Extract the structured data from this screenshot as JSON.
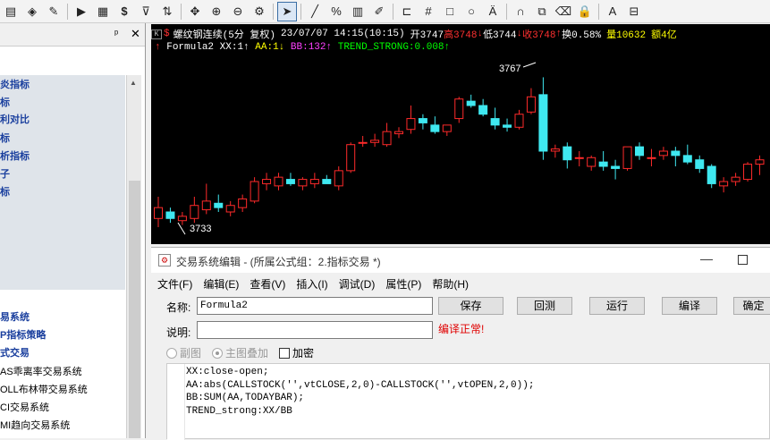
{
  "toolbar": {
    "buttons": [
      {
        "name": "menu-icon",
        "glyph": "▤"
      },
      {
        "name": "indicator-icon",
        "glyph": "◈"
      },
      {
        "name": "edit-icon",
        "glyph": "✎"
      },
      {
        "name": "play-icon",
        "glyph": "▶"
      },
      {
        "name": "document-icon",
        "glyph": "▦"
      },
      {
        "name": "dollar-icon",
        "glyph": "$"
      },
      {
        "name": "filter-icon",
        "glyph": "⊽"
      },
      {
        "name": "sync-icon",
        "glyph": "⇅"
      },
      {
        "name": "move-icon",
        "glyph": "✥"
      },
      {
        "name": "zoom-in-icon",
        "glyph": "⊕"
      },
      {
        "name": "zoom-out-icon",
        "glyph": "⊖"
      },
      {
        "name": "settings-icon",
        "glyph": "⚙"
      },
      {
        "name": "pointer-icon",
        "glyph": "➤"
      },
      {
        "name": "line-icon",
        "glyph": "╱"
      },
      {
        "name": "percent-icon",
        "glyph": "%"
      },
      {
        "name": "grid-icon",
        "glyph": "▥"
      },
      {
        "name": "pen-icon",
        "glyph": "✐"
      },
      {
        "name": "bracket-icon",
        "glyph": "⊏"
      },
      {
        "name": "hash-icon",
        "glyph": "#"
      },
      {
        "name": "rect-icon",
        "glyph": "□"
      },
      {
        "name": "circle-icon",
        "glyph": "○"
      },
      {
        "name": "text-icon",
        "glyph": "Ä"
      },
      {
        "name": "magnet-icon",
        "glyph": "∩"
      },
      {
        "name": "copy-icon",
        "glyph": "⧉"
      },
      {
        "name": "eraser-icon",
        "glyph": "⌫"
      },
      {
        "name": "lock-icon",
        "glyph": "🔒"
      },
      {
        "name": "font-color-icon",
        "glyph": "A"
      },
      {
        "name": "save-icon",
        "glyph": "⊟"
      }
    ]
  },
  "left_panel": {
    "items": [
      {
        "label": "炎指标",
        "style": "bold"
      },
      {
        "label": "标",
        "style": "bold"
      },
      {
        "label": "利对比",
        "style": "bold"
      },
      {
        "label": "标",
        "style": "bold"
      },
      {
        "label": "析指标",
        "style": "bold"
      },
      {
        "label": "子",
        "style": "bold"
      },
      {
        "label": "标",
        "style": "bold"
      },
      {
        "label": "易系统",
        "style": "bold"
      },
      {
        "label": "P指标策略",
        "style": "bold"
      },
      {
        "label": "式交易",
        "style": "bold"
      },
      {
        "label": "AS乖离率交易系统",
        "style": "plain"
      },
      {
        "label": "OLL布林带交易系统",
        "style": "plain"
      },
      {
        "label": "CI交易系统",
        "style": "plain"
      },
      {
        "label": "MI趋向交易系统",
        "style": "plain"
      }
    ]
  },
  "chart": {
    "instrument": "螺纹钢连续(5分 复权)",
    "datetime": "23/07/07 14:15(10:15)",
    "open": "开3747",
    "high": "高3748",
    "low": "低3744",
    "close": "收3748",
    "turnover": "换0.58%",
    "volume": "量10632",
    "amount": "额4亿",
    "formula_name": "Formula2",
    "xx_label": "XX:1",
    "aa_label": "AA:1",
    "bb_label": "BB:132",
    "trend_label": "TREND_STRONG:0.008",
    "high_marker": "3767",
    "low_marker": "3733",
    "colors": {
      "up": "#ff2a2a",
      "down": "#3fe8f0",
      "aa": "#ffff00",
      "bb": "#ff40ff",
      "trend": "#00ff00"
    }
  },
  "chart_data": {
    "type": "candlestick",
    "ylim": [
      3729,
      3771
    ],
    "candles": [
      {
        "o": 3734.5,
        "h": 3739.5,
        "l": 3732.5,
        "c": 3737
      },
      {
        "o": 3736,
        "h": 3737,
        "l": 3733.5,
        "c": 3734.5
      },
      {
        "o": 3734,
        "h": 3736,
        "l": 3733,
        "c": 3735
      },
      {
        "o": 3734.5,
        "h": 3739.5,
        "l": 3733.5,
        "c": 3737.5
      },
      {
        "o": 3736.5,
        "h": 3742.5,
        "l": 3735.5,
        "c": 3738.5
      },
      {
        "o": 3738,
        "h": 3740,
        "l": 3736,
        "c": 3737
      },
      {
        "o": 3736,
        "h": 3738.5,
        "l": 3735,
        "c": 3737.5
      },
      {
        "o": 3737,
        "h": 3740,
        "l": 3736,
        "c": 3739
      },
      {
        "o": 3738.5,
        "h": 3744,
        "l": 3738,
        "c": 3743
      },
      {
        "o": 3742.5,
        "h": 3745,
        "l": 3741,
        "c": 3743.5
      },
      {
        "o": 3742,
        "h": 3745,
        "l": 3741,
        "c": 3744
      },
      {
        "o": 3743.5,
        "h": 3745,
        "l": 3742,
        "c": 3742.5
      },
      {
        "o": 3742,
        "h": 3744,
        "l": 3741,
        "c": 3743.5
      },
      {
        "o": 3742.5,
        "h": 3745,
        "l": 3741.5,
        "c": 3743.5
      },
      {
        "o": 3743.5,
        "h": 3744.5,
        "l": 3742.5,
        "c": 3742.5
      },
      {
        "o": 3742,
        "h": 3746.5,
        "l": 3741,
        "c": 3745.5
      },
      {
        "o": 3745.5,
        "h": 3752,
        "l": 3745,
        "c": 3751.5
      },
      {
        "o": 3752,
        "h": 3753.5,
        "l": 3751,
        "c": 3752
      },
      {
        "o": 3752,
        "h": 3754,
        "l": 3751,
        "c": 3752.5
      },
      {
        "o": 3751.5,
        "h": 3756.5,
        "l": 3751,
        "c": 3754.5
      },
      {
        "o": 3754,
        "h": 3755.5,
        "l": 3753,
        "c": 3754.5
      },
      {
        "o": 3755,
        "h": 3760.5,
        "l": 3754,
        "c": 3757.5
      },
      {
        "o": 3757.5,
        "h": 3758.5,
        "l": 3755,
        "c": 3756.5
      },
      {
        "o": 3756,
        "h": 3758,
        "l": 3754,
        "c": 3754.5
      },
      {
        "o": 3754.5,
        "h": 3756,
        "l": 3753.5,
        "c": 3756
      },
      {
        "o": 3757.5,
        "h": 3762.5,
        "l": 3756.5,
        "c": 3762
      },
      {
        "o": 3761.5,
        "h": 3763,
        "l": 3760,
        "c": 3760.5
      },
      {
        "o": 3760.5,
        "h": 3762,
        "l": 3758,
        "c": 3758.5
      },
      {
        "o": 3757.5,
        "h": 3760,
        "l": 3755,
        "c": 3756
      },
      {
        "o": 3756,
        "h": 3757.5,
        "l": 3754.5,
        "c": 3755.5
      },
      {
        "o": 3755.5,
        "h": 3759.5,
        "l": 3755,
        "c": 3758.5
      },
      {
        "o": 3759,
        "h": 3764.5,
        "l": 3758.5,
        "c": 3762.5
      },
      {
        "o": 3763,
        "h": 3767,
        "l": 3748,
        "c": 3750
      },
      {
        "o": 3750,
        "h": 3751.5,
        "l": 3748.5,
        "c": 3750.5
      },
      {
        "o": 3751,
        "h": 3752,
        "l": 3746,
        "c": 3748
      },
      {
        "o": 3748.5,
        "h": 3750,
        "l": 3746.5,
        "c": 3748.5
      },
      {
        "o": 3746.5,
        "h": 3749,
        "l": 3745.5,
        "c": 3748.5
      },
      {
        "o": 3747.5,
        "h": 3750,
        "l": 3745.5,
        "c": 3746.5
      },
      {
        "o": 3746.5,
        "h": 3748,
        "l": 3743.5,
        "c": 3746
      },
      {
        "o": 3746,
        "h": 3751,
        "l": 3745.5,
        "c": 3751
      },
      {
        "o": 3751,
        "h": 3752,
        "l": 3748,
        "c": 3749
      },
      {
        "o": 3748.5,
        "h": 3750.5,
        "l": 3746.5,
        "c": 3748.5
      },
      {
        "o": 3749,
        "h": 3751,
        "l": 3748,
        "c": 3750
      },
      {
        "o": 3750,
        "h": 3751,
        "l": 3746.5,
        "c": 3749
      },
      {
        "o": 3749,
        "h": 3751.5,
        "l": 3747,
        "c": 3747.5
      },
      {
        "o": 3748,
        "h": 3749,
        "l": 3745,
        "c": 3746
      },
      {
        "o": 3746.5,
        "h": 3747,
        "l": 3741.5,
        "c": 3742.5
      },
      {
        "o": 3742,
        "h": 3744,
        "l": 3740.5,
        "c": 3743
      },
      {
        "o": 3743,
        "h": 3745,
        "l": 3742,
        "c": 3744
      },
      {
        "o": 3743.5,
        "h": 3747.5,
        "l": 3743,
        "c": 3747
      },
      {
        "o": 3747,
        "h": 3749,
        "l": 3744.5,
        "c": 3748
      }
    ]
  },
  "dialog": {
    "title": "交易系统编辑 - (所属公式组：2.指标交易 *)",
    "menu": [
      "文件(F)",
      "编辑(E)",
      "查看(V)",
      "插入(I)",
      "调试(D)",
      "属性(P)",
      "帮助(H)"
    ],
    "name_label": "名称:",
    "name_value": "Formula2",
    "desc_label": "说明:",
    "desc_value": "",
    "compile_status": "编译正常!",
    "buttons": {
      "save": "保存",
      "rollback": "回测",
      "run": "运行",
      "compile": "编译",
      "ok": "确定"
    },
    "radio_subchart": "副图",
    "radio_main": "主图叠加",
    "checkbox_encrypt": "加密",
    "code_lines": [
      "XX:close-open;",
      "AA:abs(CALLSTOCK('',vtCLOSE,2,0)-CALLSTOCK('',vtOPEN,2,0));",
      "BB:SUM(AA,TODAYBAR);",
      "TREND_strong:XX/BB"
    ]
  }
}
